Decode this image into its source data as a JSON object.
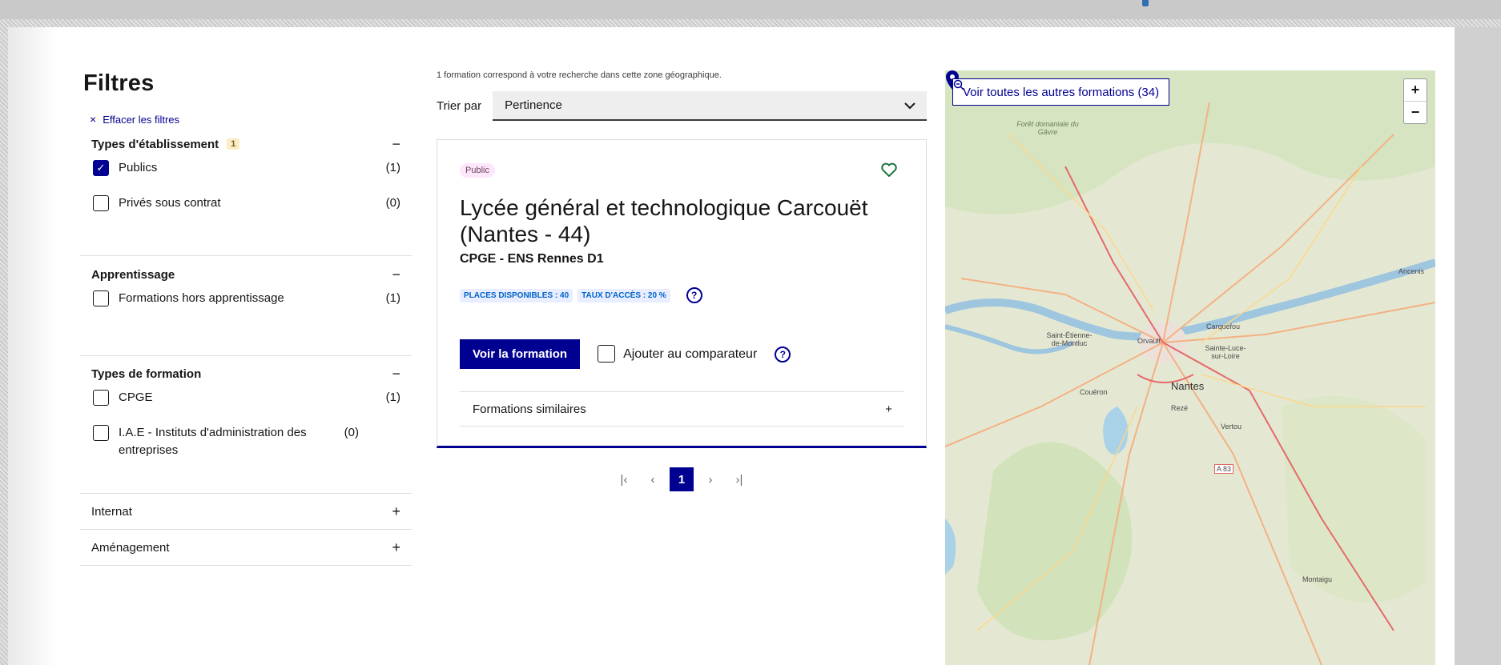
{
  "filters": {
    "title": "Filtres",
    "clear_label": "Effacer les filtres",
    "sections": [
      {
        "label": "Types d'établissement",
        "badge": "1",
        "toggle": "−",
        "options": [
          {
            "label": "Publics",
            "count": "(1)",
            "checked": true
          },
          {
            "label": "Privés sous contrat",
            "count": "(0)",
            "checked": false
          }
        ]
      },
      {
        "label": "Apprentissage",
        "toggle": "−",
        "options": [
          {
            "label": "Formations hors apprentissage",
            "count": "(1)",
            "checked": false
          }
        ]
      },
      {
        "label": "Types de formation",
        "toggle": "−",
        "options": [
          {
            "label": "CPGE",
            "count": "(1)",
            "checked": false
          },
          {
            "label": "I.A.E - Instituts d'administration des entreprises",
            "count": "(0)",
            "checked": false
          }
        ]
      },
      {
        "label": "Internat",
        "toggle": "+"
      },
      {
        "label": "Aménagement",
        "toggle": "+"
      }
    ]
  },
  "results": {
    "info": "1 formation correspond à votre recherche dans cette zone géographique.",
    "sort_label": "Trier par",
    "sort_value": "Pertinence",
    "card": {
      "tag": "Public",
      "title": "Lycée général et technologique Carcouët (Nantes - 44)",
      "subtitle": "CPGE - ENS Rennes D1",
      "pill_places": "PLACES DISPONIBLES : 40",
      "pill_taux": "TAUX D'ACCÈS : 20 %",
      "help": "?",
      "cta": "Voir la formation",
      "compare_label": "Ajouter au comparateur",
      "similar_label": "Formations similaires",
      "similar_toggle": "+"
    },
    "pagination": {
      "first": "|‹",
      "prev": "‹",
      "current": "1",
      "next": "›",
      "last": "›|"
    }
  },
  "map": {
    "cta_label": "Voir toutes les autres formations (34)",
    "zoom_in": "+",
    "zoom_out": "−",
    "places": {
      "foret": "Forêt domaniale du Gâvre",
      "ancenis": "Ancenis",
      "carquefou": "Carquefou",
      "saint_etienne": "Saint-Étienne-de-Montluc",
      "orvault": "Orvault",
      "sainte_luce": "Sainte-Luce-sur-Loire",
      "nantes": "Nantes",
      "coueron": "Couëron",
      "reze": "Rezé",
      "vertou": "Vertou",
      "a83": "A 83",
      "montaigu": "Montaigu"
    }
  },
  "colors": {
    "primary": "#000091",
    "tag_public_bg": "#fee7fc",
    "pill_bg": "#e8edff",
    "heart": "#18753c"
  }
}
